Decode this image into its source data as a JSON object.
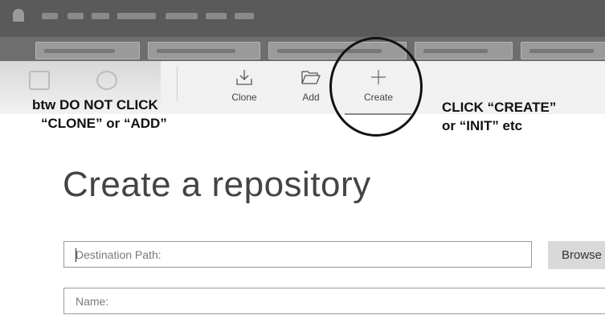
{
  "toolbar": {
    "clone_label": "Clone",
    "add_label": "Add",
    "create_label": "Create"
  },
  "annotations": {
    "left_line1": "btw DO NOT CLICK",
    "left_line2": "“CLONE” or “ADD”",
    "right_line1": "CLICK “CREATE”",
    "right_line2": "or “INIT” etc"
  },
  "main": {
    "title": "Create a repository",
    "destination_placeholder": "Destination Path:",
    "name_placeholder": "Name:",
    "browse_label": "Browse"
  },
  "icons": {
    "clone": "download-icon",
    "add": "folder-open-icon",
    "create": "plus-icon"
  },
  "colors": {
    "menubar": "#5a5a5a",
    "tabstrip": "#6e6e6e",
    "toolbar": "#f1f1f1",
    "highlight_circle": "#111111"
  }
}
